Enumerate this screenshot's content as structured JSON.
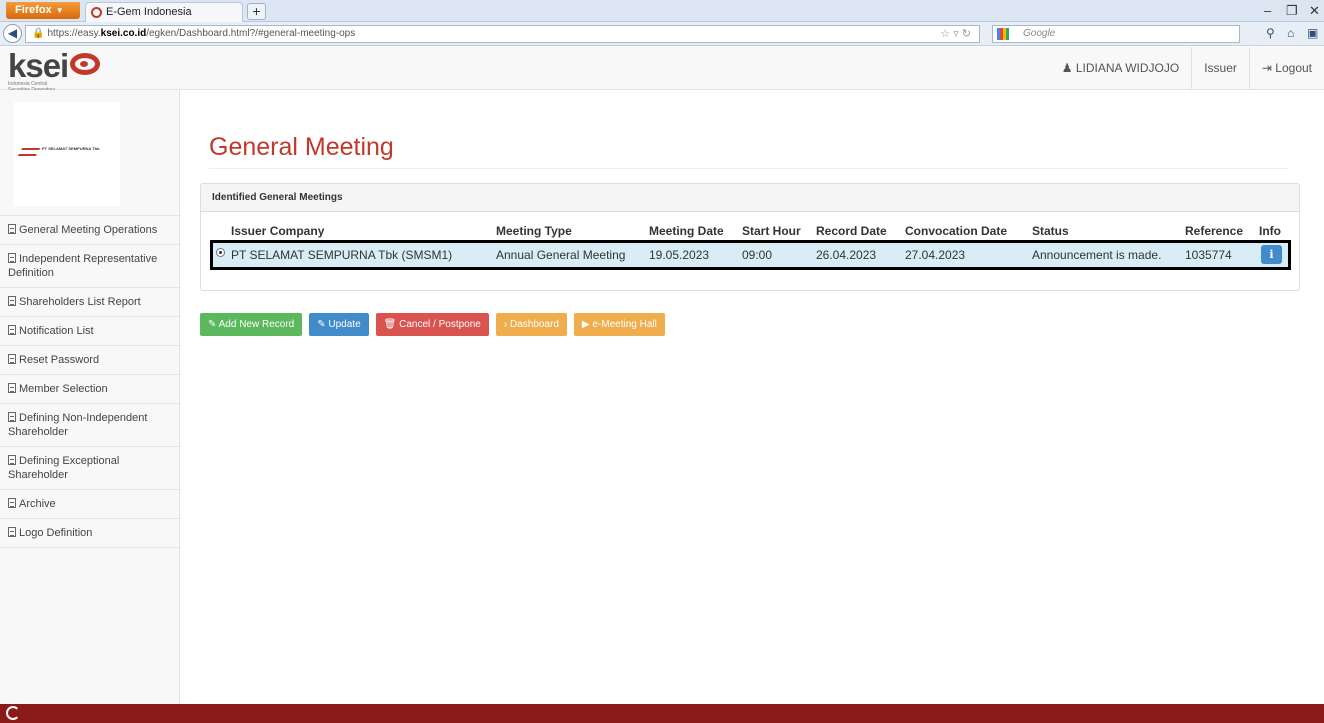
{
  "browser": {
    "menu_label": "Firefox",
    "tab_title": "E-Gem Indonesia",
    "new_tab": "+",
    "url_prefix": "https://easy.",
    "url_domain": "ksei.co.id",
    "url_path": "/egken/Dashboard.html?/#general-meeting-ops",
    "search_placeholder": "Google",
    "controls": {
      "minimize": "–",
      "restore": "❐",
      "close": "✕"
    }
  },
  "header": {
    "logo_text": "ksei",
    "logo_subtitle": "Indonesia Central Securities Depository",
    "user_name": "LIDIANA WIDJOJO",
    "role": "Issuer",
    "logout_label": "Logout"
  },
  "sidebar": {
    "company_name": "PT SELAMAT SEMPURNA Tbk.",
    "items": [
      {
        "label": "General Meeting Operations"
      },
      {
        "label": "Independent Representative Definition"
      },
      {
        "label": "Shareholders List Report"
      },
      {
        "label": "Notification List"
      },
      {
        "label": "Reset Password"
      },
      {
        "label": "Member Selection"
      },
      {
        "label": "Defining Non-Independent Shareholder"
      },
      {
        "label": "Defining Exceptional Shareholder"
      },
      {
        "label": "Archive"
      },
      {
        "label": "Logo Definition"
      }
    ]
  },
  "main": {
    "title": "General Meeting",
    "panel_title": "Identified General Meetings",
    "columns": {
      "issuer": "Issuer Company",
      "type": "Meeting Type",
      "date": "Meeting Date",
      "hour": "Start Hour",
      "record": "Record Date",
      "convocation": "Convocation Date",
      "status": "Status",
      "reference": "Reference",
      "info": "Info"
    },
    "rows": [
      {
        "issuer": "PT SELAMAT SEMPURNA Tbk (SMSM1)",
        "type": "Annual General Meeting",
        "date": "19.05.2023",
        "hour": "09:00",
        "record": "26.04.2023",
        "convocation": "27.04.2023",
        "status": "Announcement is made.",
        "reference": "1035774",
        "info": "i"
      }
    ],
    "actions": {
      "add": "Add New Record",
      "update": "Update",
      "cancel": "Cancel / Postpone",
      "dashboard": "Dashboard",
      "hall": "e-Meeting Hall"
    }
  },
  "colors": {
    "accent": "#c0392b",
    "footer": "#8b1a1a",
    "selected_row": "#d9edf7"
  }
}
